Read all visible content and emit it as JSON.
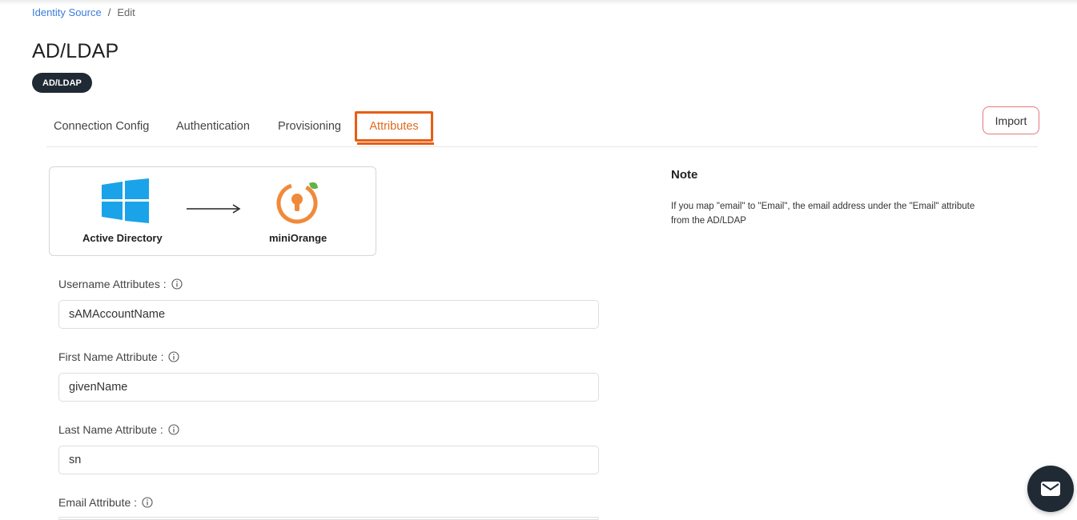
{
  "breadcrumb": {
    "parent": "Identity Source",
    "separator": "/",
    "current": "Edit"
  },
  "page": {
    "title": "AD/LDAP",
    "badge": "AD/LDAP"
  },
  "tabs": [
    {
      "label": "Connection Config",
      "active": false
    },
    {
      "label": "Authentication",
      "active": false
    },
    {
      "label": "Provisioning",
      "active": false
    },
    {
      "label": "Attributes",
      "active": true
    }
  ],
  "toolbar": {
    "import_label": "Import"
  },
  "mapping": {
    "source_label": "Active Directory",
    "target_label": "miniOrange",
    "source_icon": "windows-logo-icon",
    "target_icon": "miniorange-logo-icon",
    "arrow_icon": "arrow-right-icon"
  },
  "note": {
    "title": "Note",
    "text": "If you map \"email\" to \"Email\", the email address under the \"Email\" attribute from the AD/LDAP"
  },
  "fields": [
    {
      "label": "Username Attributes :",
      "value": "sAMAccountName"
    },
    {
      "label": "First Name Attribute :",
      "value": "givenName"
    },
    {
      "label": "Last Name Attribute :",
      "value": "sn"
    },
    {
      "label": "Email Attribute :",
      "value": ""
    }
  ],
  "colors": {
    "accent": "#e85d14",
    "link": "#3b7ddd",
    "badge_bg": "#1f2a35",
    "windows_blue": "#1aa3e8",
    "miniorange_orange": "#f08a3a",
    "miniorange_leaf": "#5fb44a"
  },
  "chat_button": {
    "icon": "mail-icon"
  }
}
